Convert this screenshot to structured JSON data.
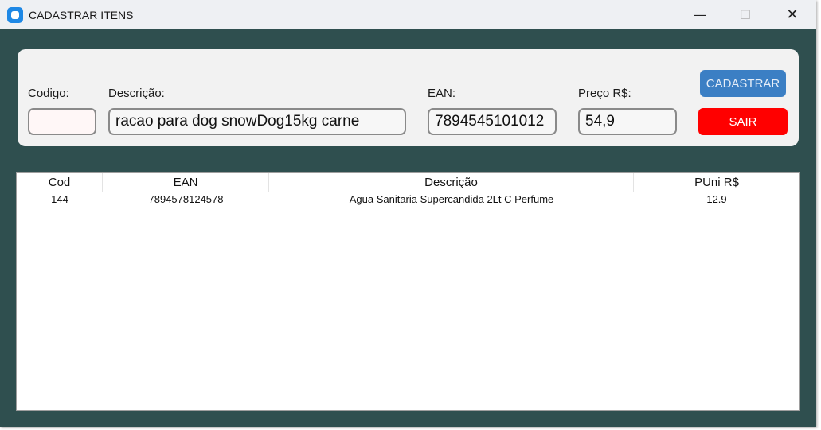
{
  "window": {
    "title": "CADASTRAR ITENS",
    "controls": {
      "minimize": "—",
      "maximize": "☐",
      "close": "✕"
    }
  },
  "form": {
    "codigo": {
      "label": "Codigo:",
      "value": ""
    },
    "descricao": {
      "label": "Descrição:",
      "value": "racao para dog snowDog15kg carne"
    },
    "ean": {
      "label": "EAN:",
      "value": "7894545101012"
    },
    "preco": {
      "label": "Preço R$:",
      "value": "54,9"
    },
    "cadastrar_label": "CADASTRAR",
    "sair_label": "SAIR"
  },
  "table": {
    "columns": [
      "Cod",
      "EAN",
      "Descrição",
      "PUni R$"
    ],
    "rows": [
      {
        "cod": "144",
        "ean": "7894578124578",
        "descricao": "Agua Sanitaria Supercandida 2Lt C Perfume",
        "puni": "12.9"
      }
    ]
  },
  "colors": {
    "background": "#2f4f4f",
    "panel": "#f2f2f2",
    "cadastrar_button": "#3b7fc4",
    "sair_button": "#ff0000"
  }
}
